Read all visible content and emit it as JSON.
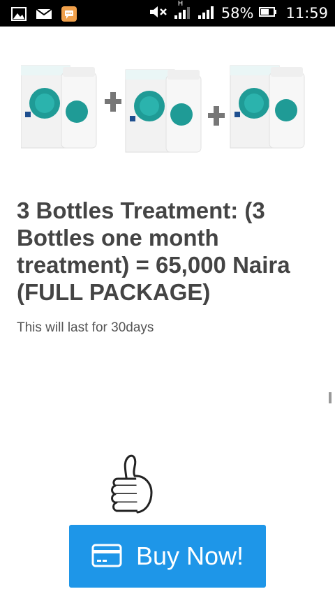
{
  "status_bar": {
    "battery": "58%",
    "time": "11:59",
    "network_label": "H",
    "icons": [
      "image-icon",
      "mail-icon",
      "chat-icon",
      "mute-icon",
      "signal-icon",
      "signal-icon",
      "battery-icon"
    ]
  },
  "product": {
    "image": "three-bottles-product-image",
    "title": "3 Bottles Treatment: (3 Bottles one month treatment) = 65,000 Naira (FULL PACKAGE)",
    "subtitle": "This will last for 30days"
  },
  "cta": {
    "buy_label": "Buy Now!",
    "icon": "credit-card-icon",
    "accent": "#1e96e8"
  },
  "decor": {
    "thumbs_icon": "thumbs-up-icon"
  }
}
